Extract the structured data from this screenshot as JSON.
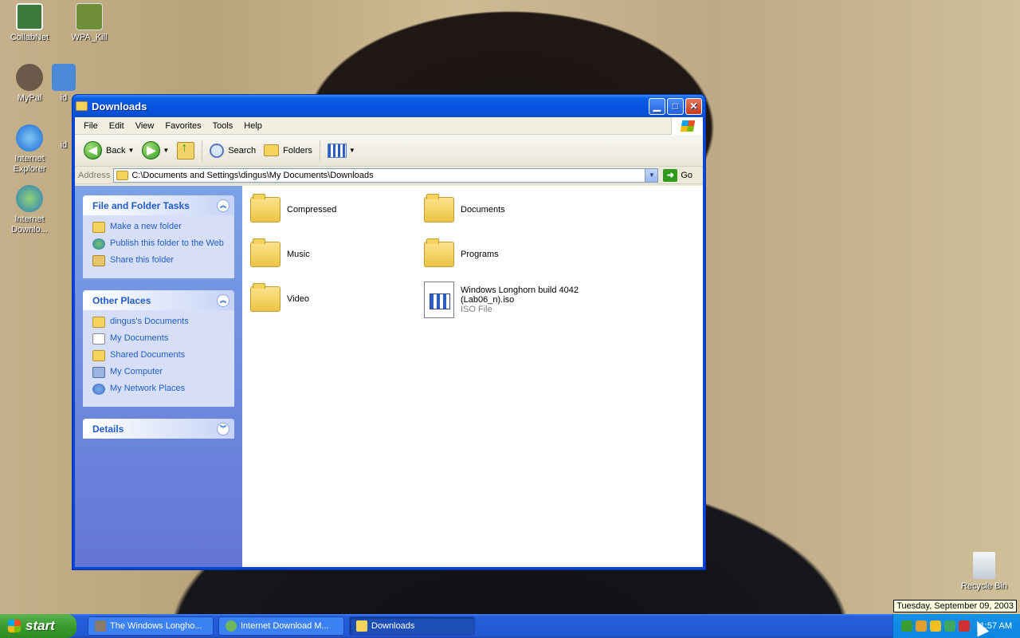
{
  "desktop_icons": [
    {
      "label": "CollabNet"
    },
    {
      "label": "WPA_Kill"
    },
    {
      "label": "MyPal"
    },
    {
      "label": "id"
    },
    {
      "label": "Internet Explorer"
    },
    {
      "label": "id"
    },
    {
      "label": "Internet Downlo..."
    },
    {
      "label": "Recycle Bin"
    }
  ],
  "window": {
    "title": "Downloads",
    "menu": [
      "File",
      "Edit",
      "View",
      "Favorites",
      "Tools",
      "Help"
    ],
    "toolbar": {
      "back": "Back",
      "search": "Search",
      "folders": "Folders"
    },
    "address": {
      "label": "Address",
      "value": "C:\\Documents and Settings\\dingus\\My Documents\\Downloads",
      "go": "Go"
    },
    "task_pane": {
      "file_tasks": {
        "title": "File and Folder Tasks",
        "items": [
          "Make a new folder",
          "Publish this folder to the Web",
          "Share this folder"
        ]
      },
      "other_places": {
        "title": "Other Places",
        "items": [
          "dingus's Documents",
          "My Documents",
          "Shared Documents",
          "My Computer",
          "My Network Places"
        ]
      },
      "details": {
        "title": "Details"
      }
    },
    "files": [
      {
        "name": "Compressed",
        "type": "folder"
      },
      {
        "name": "Documents",
        "type": "folder"
      },
      {
        "name": "Music",
        "type": "folder"
      },
      {
        "name": "Programs",
        "type": "folder"
      },
      {
        "name": "Video",
        "type": "folder"
      },
      {
        "name": "Windows Longhorn build 4042 (Lab06_n).iso",
        "type": "ISO File"
      }
    ]
  },
  "taskbar": {
    "start": "start",
    "tasks": [
      "The Windows Longho...",
      "Internet Download M...",
      "Downloads"
    ],
    "clock": "1:57 AM",
    "tooltip": "Tuesday, September 09, 2003"
  },
  "colors": {
    "title_blue": "#0553e0",
    "link_blue": "#215dc6",
    "start_green": "#3a9c2f"
  }
}
